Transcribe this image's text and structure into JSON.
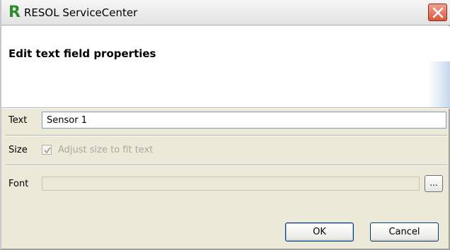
{
  "window": {
    "app_logo": "R",
    "title": "RESOL ServiceCenter",
    "close_icon": "close-icon"
  },
  "header": {
    "title": "Edit text field properties"
  },
  "form": {
    "text_label": "Text",
    "text_value": "Sensor 1",
    "size_label": "Size",
    "adjust_label": "Adjust size to fit text",
    "adjust_checked": true,
    "adjust_disabled": true,
    "font_label": "Font",
    "font_value": "",
    "browse_label": "..."
  },
  "buttons": {
    "ok": "OK",
    "cancel": "Cancel"
  }
}
